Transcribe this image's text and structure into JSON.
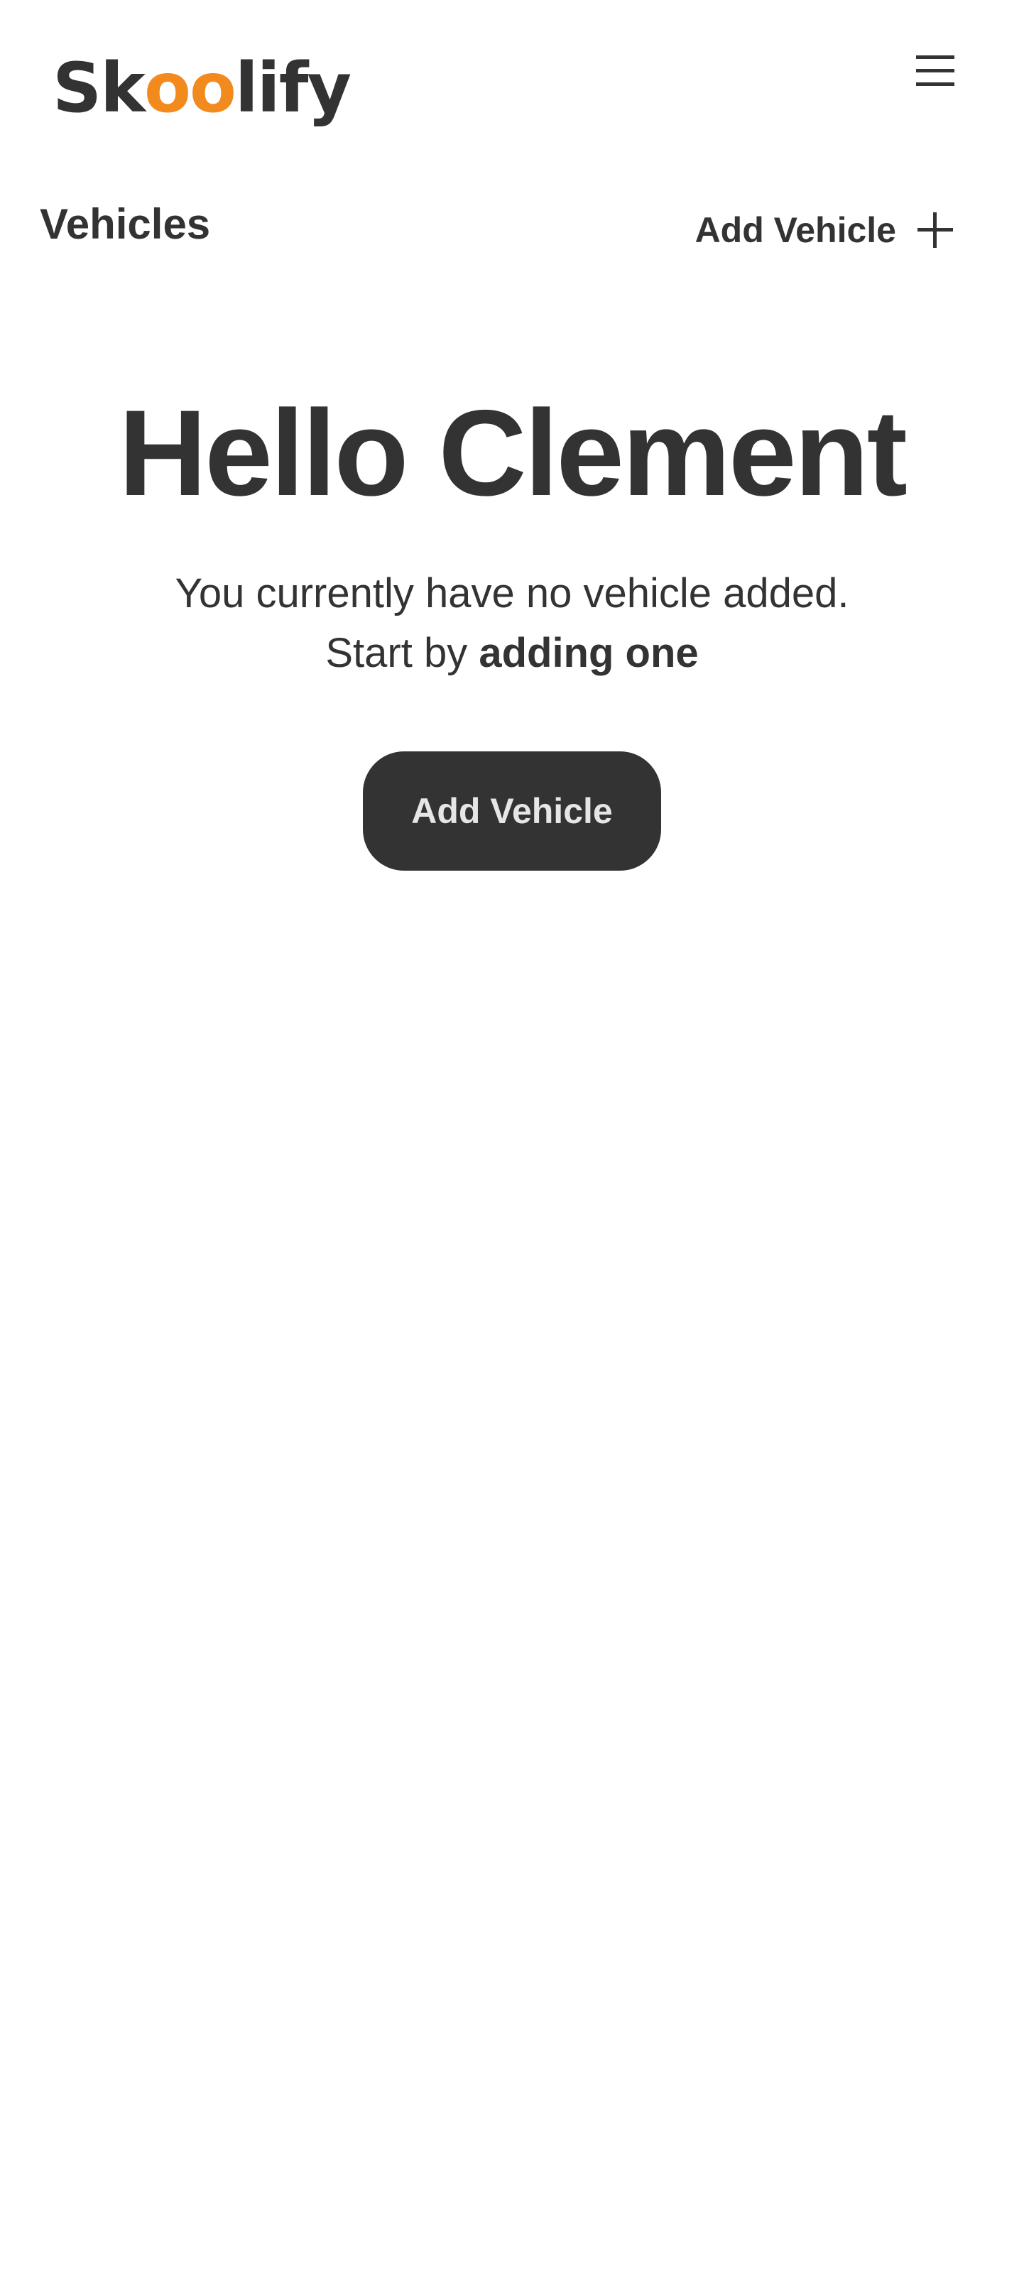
{
  "header": {
    "logo": {
      "prefix": "Sk",
      "eyes": "oo",
      "suffix": "lify",
      "accent_color": "#f28a1e"
    },
    "menu_icon": "hamburger-menu-icon"
  },
  "title_row": {
    "title": "Vehicles",
    "add_link_label": "Add Vehicle",
    "add_icon": "plus-icon"
  },
  "main": {
    "greeting": "Hello Clement",
    "line1": "You currently have no vehicle added.",
    "line2_prefix": "Start by ",
    "line2_bold": "adding one",
    "cta_label": "Add Vehicle"
  },
  "colors": {
    "text": "#333333",
    "button_bg": "#333333",
    "button_text": "#e6e6e6",
    "accent": "#f28a1e"
  }
}
